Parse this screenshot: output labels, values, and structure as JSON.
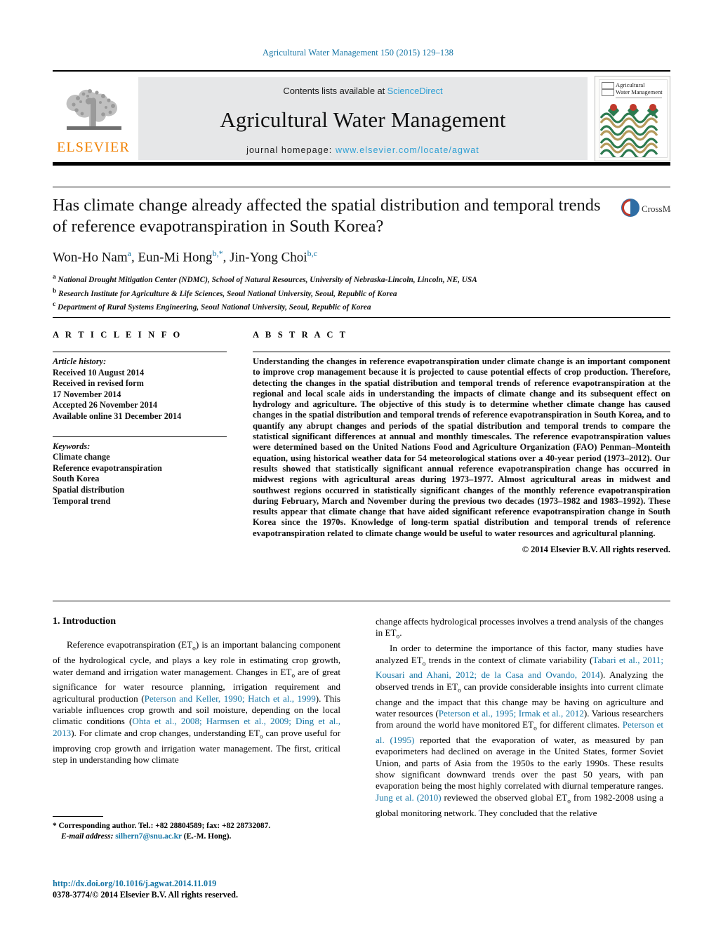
{
  "running_head": "Agricultural Water Management 150 (2015) 129–138",
  "masthead": {
    "contents_prefix": "Contents lists available at ",
    "sciencedirect": "ScienceDirect",
    "journal_title": "Agricultural Water Management",
    "homepage_prefix": "journal homepage:",
    "homepage_url": "www.elsevier.com/locate/agwat",
    "publisher_logo_text": "ELSEVIER",
    "cover_title_line1": "Agricultural",
    "cover_title_line2": "Water Management"
  },
  "colors": {
    "link": "#1474a4",
    "sciencedirect": "#2e9fd4",
    "elsevier_orange": "#f08000",
    "masthead_bg": "#e6e7e8",
    "cover_green": "#2c7a50",
    "cover_tan": "#b59a5c",
    "cover_red": "#c0392b",
    "crossmark_blue": "#2e6da4",
    "crossmark_red": "#c0392b"
  },
  "article": {
    "title": "Has climate change already affected the spatial distribution and temporal trends of reference evapotranspiration in South Korea?",
    "authors_html": "Won-Ho Nam<sup>a</sup>, Eun-Mi Hong<sup>b,*</sup>, Jin-Yong Choi<sup>b,c</sup>",
    "affiliations": [
      {
        "marker": "a",
        "text": "National Drought Mitigation Center (NDMC), School of Natural Resources, University of Nebraska-Lincoln, Lincoln, NE, USA"
      },
      {
        "marker": "b",
        "text": "Research Institute for Agriculture & Life Sciences, Seoul National University, Seoul, Republic of Korea"
      },
      {
        "marker": "c",
        "text": "Department of Rural Systems Engineering, Seoul National University, Seoul, Republic of Korea"
      }
    ],
    "crossmark_label": "CrossMark"
  },
  "article_info": {
    "heading": "A R T I C L E    I N F O",
    "history_label": "Article history:",
    "history": [
      "Received 10 August 2014",
      "Received in revised form",
      "17 November 2014",
      "Accepted 26 November 2014",
      "Available online 31 December 2014"
    ],
    "keywords_label": "Keywords:",
    "keywords": [
      "Climate change",
      "Reference evapotranspiration",
      "South Korea",
      "Spatial distribution",
      "Temporal trend"
    ]
  },
  "abstract": {
    "heading": "A B S T R A C T",
    "text": "Understanding the changes in reference evapotranspiration under climate change is an important component to improve crop management because it is projected to cause potential effects of crop production. Therefore, detecting the changes in the spatial distribution and temporal trends of reference evapotranspiration at the regional and local scale aids in understanding the impacts of climate change and its subsequent effect on hydrology and agriculture. The objective of this study is to determine whether climate change has caused changes in the spatial distribution and temporal trends of reference evapotranspiration in South Korea, and to quantify any abrupt changes and periods of the spatial distribution and temporal trends to compare the statistical significant differences at annual and monthly timescales. The reference evapotranspiration values were determined based on the United Nations Food and Agriculture Organization (FAO) Penman–Monteith equation, using historical weather data for 54 meteorological stations over a 40-year period (1973–2012). Our results showed that statistically significant annual reference evapotranspiration change has occurred in midwest regions with agricultural areas during 1973–1977. Almost agricultural areas in midwest and southwest regions occurred in statistically significant changes of the monthly reference evapotranspiration during February, March and November during the previous two decades (1973–1982 and 1983–1992). These results appear that climate change that have aided significant reference evapotranspiration change in South Korea since the 1970s. Knowledge of long-term spatial distribution and temporal trends of reference evapotranspiration related to climate change would be useful to water resources and agricultural planning.",
    "copyright": "© 2014 Elsevier B.V. All rights reserved."
  },
  "body": {
    "section_heading": "1.  Introduction",
    "left_paragraph_1_html": "Reference evapotranspiration (ET<sub>o</sub>) is an important balancing component of the hydrological cycle, and plays a key role in estimating crop growth, water demand and irrigation water management. Changes in ET<sub>o</sub> are of great significance for water resource planning, irrigation requirement and agricultural production (<span class=\"ref\">Peterson and Keller, 1990; Hatch et al., 1999</span>). This variable influences crop growth and soil moisture, depending on the local climatic conditions (<span class=\"ref\">Ohta et al., 2008; Harmsen et al., 2009; Ding et al., 2013</span>). For climate and crop changes, understanding ET<sub>o</sub> can prove useful for improving crop growth and irrigation water management. The first, critical step in understanding how climate",
    "right_paragraph_1_html": "change affects hydrological processes involves a trend analysis of the changes in ET<sub>o</sub>.",
    "right_paragraph_2_html": "In order to determine the importance of this factor, many studies have analyzed ET<sub>o</sub> trends in the context of climate variability (<span class=\"ref\">Tabari et al., 2011; Kousari and Ahani, 2012; de la Casa and Ovando, 2014</span>). Analyzing the observed trends in ET<sub>o</sub> can provide considerable insights into current climate change and the impact that this change may be having on agriculture and water resources (<span class=\"ref\">Peterson et al., 1995; Irmak et al., 2012</span>). Various researchers from around the world have monitored ET<sub>o</sub> for different climates. <span class=\"ref\">Peterson et al. (1995)</span> reported that the evaporation of water, as measured by pan evaporimeters had declined on average in the United States, former Soviet Union, and parts of Asia from the 1950s to the early 1990s. These results show significant downward trends over the past 50 years, with pan evaporation being the most highly correlated with diurnal temperature ranges. <span class=\"ref\">Jung et al. (2010)</span> reviewed the observed global ET<sub>o</sub> from 1982-2008 using a global monitoring network. They concluded that the relative"
  },
  "footnote": {
    "line1": "* Corresponding author. Tel.: +82 28804589; fax: +82 28732087.",
    "email_label": "E-mail address:",
    "email": "silhern7@snu.ac.kr",
    "email_suffix": "(E.-M. Hong)."
  },
  "footer": {
    "doi": "http://dx.doi.org/10.1016/j.agwat.2014.11.019",
    "issn_line": "0378-3774/© 2014 Elsevier B.V. All rights reserved."
  }
}
